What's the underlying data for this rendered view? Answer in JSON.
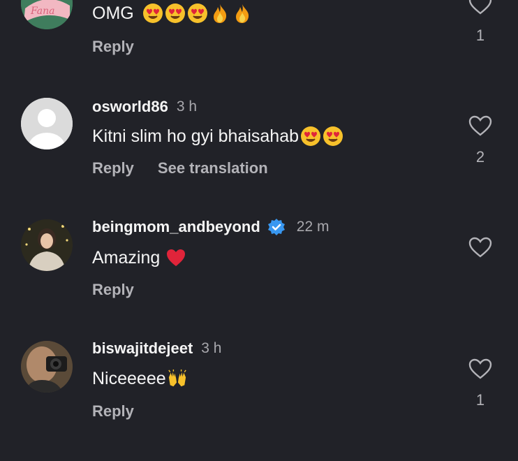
{
  "comments": [
    {
      "username": "",
      "time": "",
      "text": "OMG",
      "emojis": [
        "heart-eyes",
        "heart-eyes",
        "heart-eyes",
        "fire",
        "fire"
      ],
      "actions": [
        "Reply"
      ],
      "likes": "1",
      "avatar": "pink-logo-avatar"
    },
    {
      "username": "osworld86",
      "time": "3 h",
      "text": "Kitni slim ho gyi bhaisahab",
      "emojis": [
        "heart-eyes",
        "heart-eyes"
      ],
      "actions": [
        "Reply",
        "See translation"
      ],
      "likes": "2",
      "avatar": "default-avatar"
    },
    {
      "username": "beingmom_andbeyond",
      "time": "22 m",
      "text": "Amazing",
      "emojis": [
        "red-heart"
      ],
      "actions": [
        "Reply"
      ],
      "likes": "",
      "verified": true,
      "avatar": "woman-photo-avatar"
    },
    {
      "username": "biswajitdejeet",
      "time": "3 h",
      "text": "Niceeeee",
      "emojis": [
        "raising-hands"
      ],
      "actions": [
        "Reply"
      ],
      "likes": "1",
      "avatar": "camera-man-avatar"
    }
  ],
  "colors": {
    "background": "#212228",
    "verified": "#3897f0",
    "heart": "#e0243a",
    "emoji": "#f7c12b"
  }
}
